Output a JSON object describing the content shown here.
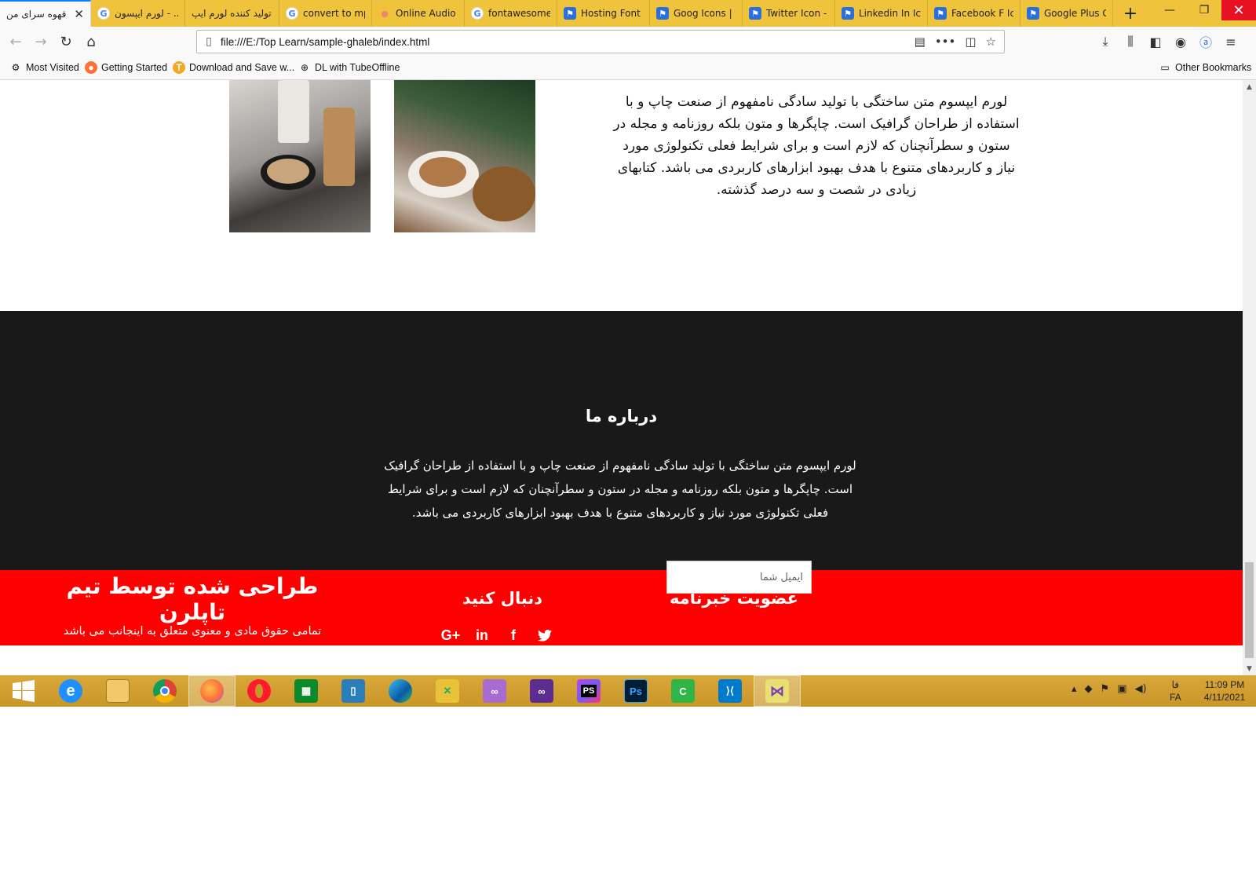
{
  "browser": {
    "tabs": [
      {
        "label": "قهوه سرای من",
        "favicon": ""
      },
      {
        "label": "لورم ایپسون - ...",
        "favicon": "G"
      },
      {
        "label": "تولید کننده لورم ایپ...",
        "favicon": ""
      },
      {
        "label": "convert to mp...",
        "favicon": "G"
      },
      {
        "label": "Online Audio C...",
        "favicon": "•"
      },
      {
        "label": "fontawesome ...",
        "favicon": "G"
      },
      {
        "label": "Hosting Font A...",
        "favicon": "⚑"
      },
      {
        "label": "Goog Icons | F...",
        "favicon": "⚑"
      },
      {
        "label": "Twitter Icon - ...",
        "favicon": "⚑"
      },
      {
        "label": "Linkedin In Ico...",
        "favicon": "⚑"
      },
      {
        "label": "Facebook F Ico...",
        "favicon": "⚑"
      },
      {
        "label": "Google Plus G...",
        "favicon": "⚑"
      }
    ],
    "url": "file:///E:/Top Learn/sample-ghaleb/index.html",
    "bookmarks": [
      {
        "label": "Most Visited",
        "icon": "gear-icon"
      },
      {
        "label": "Getting Started",
        "icon": "firefox-icon"
      },
      {
        "label": "Download and Save w...",
        "icon": "t-icon"
      },
      {
        "label": "DL with TubeOffline",
        "icon": "globe-icon"
      },
      {
        "label": "Other Bookmarks",
        "icon": "folder-icon"
      }
    ]
  },
  "page": {
    "intro_text": "لورم ایپسوم متن ساختگی با تولید سادگی نامفهوم از صنعت چاپ و با استفاده از طراحان گرافیک است. چاپگرها و متون بلکه روزنامه و مجله در ستون و سطرآنچنان که لازم است و برای شرایط فعلی تکنولوژی مورد نیاز و کاربردهای متنوع با هدف بهبود ابزارهای کاربردی می باشد. کتابهای زیادی در شصت و سه درصد گذشته.",
    "about": {
      "title": "درباره ما",
      "text": "لورم ایپسوم متن ساختگی با تولید سادگی نامفهوم از صنعت چاپ و با استفاده از طراحان گرافیک است. چاپگرها و متون بلکه روزنامه و مجله در ستون و سطرآنچنان که لازم است و برای شرایط فعلی تکنولوژی مورد نیاز و کاربردهای متنوع با هدف بهبود ابزارهای کاربردی می باشد."
    },
    "footer": {
      "credit": "طراحی شده توسط تیم تاپلرن",
      "rights": "تمامی حقوق مادی و معنوی متعلق به اینجانب می باشد",
      "follow_title": "دنبال کنید",
      "newsletter_title": "عضویت خبرنامه",
      "email_placeholder": "ایمیل شما",
      "social": [
        "G+",
        "in",
        "f",
        "twitter"
      ]
    },
    "colors": {
      "about_bg": "#191919",
      "footer_bg": "#ff0000"
    }
  },
  "taskbar": {
    "apps": [
      "windows-start",
      "internet-explorer",
      "file-explorer",
      "chrome",
      "firefox",
      "opera",
      "store",
      "app-frame",
      "edge",
      "app-tool",
      "visual-studio-purple",
      "visual-studio",
      "phpstorm",
      "photoshop",
      "camtasia",
      "vscode",
      "app-active"
    ],
    "lang_top": "فا",
    "lang_bottom": "FA",
    "time": "11:09 PM",
    "date": "4/11/2021"
  }
}
